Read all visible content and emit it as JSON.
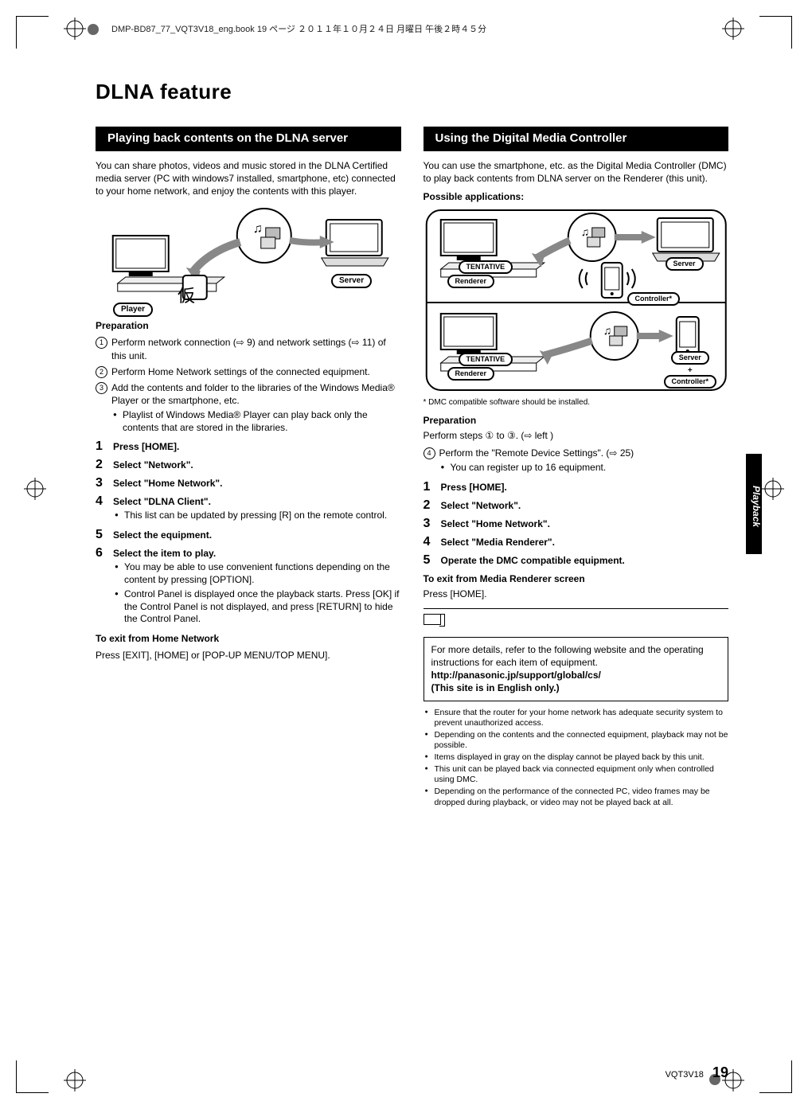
{
  "book_header": "DMP-BD87_77_VQT3V18_eng.book  19 ページ  ２０１１年１０月２４日  月曜日  午後２時４５分",
  "title": "DLNA feature",
  "left": {
    "section_title": "Playing back contents on the DLNA server",
    "intro": "You can share photos, videos and music stored in the DLNA Certified media server (PC with windows7 installed, smartphone, etc) connected to your home network, and enjoy the contents with this player.",
    "diagram": {
      "player_label": "Player",
      "server_label": "Server",
      "kanji": "仮"
    },
    "prep_head": "Preparation",
    "prep": [
      "Perform network connection (⇨ 9) and network settings (⇨ 11) of this unit.",
      "Perform Home Network settings of the connected equipment.",
      "Add the contents and folder to the libraries of the Windows Media® Player or the smartphone, etc."
    ],
    "prep_sub_bullet": "Playlist of Windows Media® Player can play back only the contents that are stored in the libraries.",
    "steps": [
      "Press [HOME].",
      "Select \"Network\".",
      "Select \"Home Network\".",
      "Select \"DLNA Client\".",
      "Select the equipment.",
      "Select the item to play."
    ],
    "step4_bullet": "This list can be updated by pressing [R] on the remote control.",
    "step6_bullets": [
      "You may be able to use convenient functions depending on the content by pressing [OPTION].",
      "Control Panel is displayed once the playback starts. Press [OK] if the Control Panel is not displayed, and press [RETURN] to hide the Control Panel."
    ],
    "exit_head": "To exit from Home Network",
    "exit_body": "Press [EXIT], [HOME] or [POP-UP MENU/TOP MENU]."
  },
  "right": {
    "section_title": "Using the Digital Media Controller",
    "intro": "You can use the smartphone, etc. as the Digital Media Controller (DMC) to play back contents from DLNA server on the Renderer (this unit).",
    "possible_head": "Possible applications:",
    "diagram": {
      "tentative": "TENTATIVE",
      "renderer": "Renderer",
      "server": "Server",
      "controller": "Controller*",
      "server_controller_top": "Server",
      "server_controller_plus": "+",
      "server_controller_bot": "Controller*"
    },
    "footnote": "DMC compatible software should be installed.",
    "prep_head": "Preparation",
    "prep_line": "Perform steps ① to ③. (⇨ left )",
    "prep4": "Perform the \"Remote Device Settings\". (⇨ 25)",
    "prep4_bullet": "You can register up to 16 equipment.",
    "steps": [
      "Press [HOME].",
      "Select \"Network\".",
      "Select \"Home Network\".",
      "Select \"Media Renderer\".",
      "Operate the DMC compatible equipment."
    ],
    "exit_head": "To exit from Media Renderer screen",
    "exit_body": "Press [HOME].",
    "info_box_line1": "For more details, refer to the following website and the operating instructions for each item of equipment.",
    "info_box_url": "http://panasonic.jp/support/global/cs/",
    "info_box_line3": "(This site is in English only.)",
    "small_bullets": [
      "Ensure that the router for your home network has adequate security system to prevent unauthorized access.",
      "Depending on the contents and the connected equipment, playback may not be possible.",
      "Items displayed in gray on the display cannot be played back by this unit.",
      "This unit can be played back via connected equipment only when controlled using DMC.",
      "Depending on the performance of the connected PC, video frames may be dropped during playback, or video may not be played back at all."
    ]
  },
  "sidetab": "Playback",
  "footer_code": "VQT3V18",
  "footer_page": "19"
}
